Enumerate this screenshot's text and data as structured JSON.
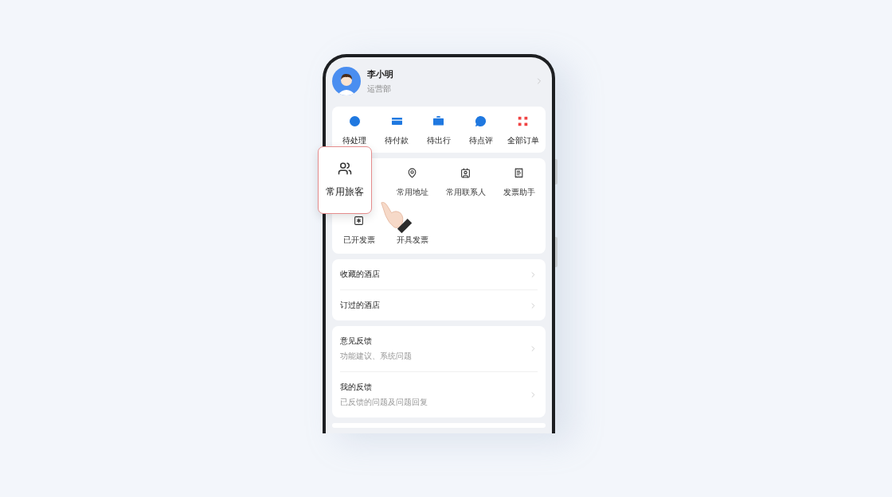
{
  "profile": {
    "name": "李小明",
    "department": "运营部"
  },
  "orders": [
    {
      "label": "待处理"
    },
    {
      "label": "待付款"
    },
    {
      "label": "待出行"
    },
    {
      "label": "待点评"
    },
    {
      "label": "全部订单"
    }
  ],
  "tools": [
    {
      "label": "常用旅客",
      "highlighted": true
    },
    {
      "label": "常用地址",
      "highlighted": false
    },
    {
      "label": "常用联系人",
      "highlighted": false
    },
    {
      "label": "发票助手",
      "highlighted": false
    },
    {
      "label": "已开发票",
      "highlighted": false
    },
    {
      "label": "开具发票",
      "highlighted": false
    }
  ],
  "hotel_links": [
    {
      "title": "收藏的酒店"
    },
    {
      "title": "订过的酒店"
    }
  ],
  "feedback_links": [
    {
      "title": "意见反馈",
      "subtitle": "功能建议、系统问题"
    },
    {
      "title": "我的反馈",
      "subtitle": "已反馈的问题及问题回复"
    }
  ]
}
